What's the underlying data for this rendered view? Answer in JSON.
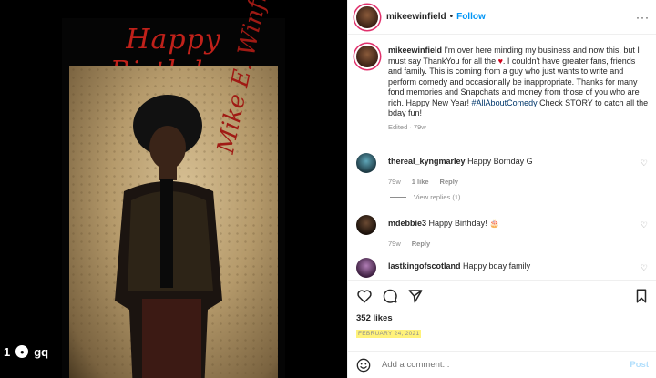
{
  "media": {
    "poster_title": "Happy Birthday",
    "signature": "Mike E. Winfield",
    "footer_icon": "1",
    "footer_logo": "gq"
  },
  "header": {
    "username": "mikeewinfield",
    "separator": "•",
    "follow_label": "Follow",
    "more_label": "···"
  },
  "caption": {
    "username": "mikeewinfield",
    "text_1": "I'm over here minding my business and now this, but I must say ThankYou for all the ",
    "heart": "♥",
    "text_2": ". I couldn't have greater fans, friends and family. This is coming from a guy who just wants to write and perform comedy and occasionally be inappropriate. Thanks for many fond memories and Snapchats and money from those of you who are rich. Happy New Year! ",
    "hashtag": "#AllAboutComedy",
    "text_3": " Check STORY to catch all the bday fun!",
    "edited": "Edited · 79w"
  },
  "comments": [
    {
      "username": "thereal_kyngmarley",
      "text": "Happy Bornday G",
      "time": "79w",
      "likes": "1 like",
      "reply": "Reply"
    },
    {
      "username": "mdebbie3",
      "text": "Happy Birthday! 🎂",
      "time": "79w",
      "reply": "Reply"
    },
    {
      "username": "lastkingofscotland",
      "text": "Happy bday family"
    }
  ],
  "view_replies": "View replies (1)",
  "likes": "352 likes",
  "date": "FEBRUARY 24, 2021",
  "add_comment": {
    "placeholder": "Add a comment...",
    "post_label": "Post"
  },
  "icons": [
    "heart-icon",
    "comment-icon",
    "share-icon",
    "bookmark-icon",
    "emoji-icon",
    "more-icon"
  ]
}
